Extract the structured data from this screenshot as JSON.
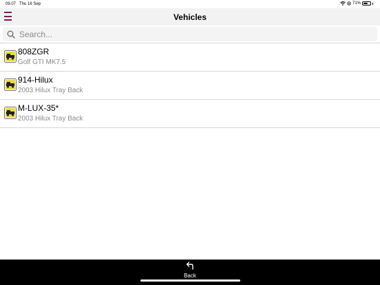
{
  "status_bar": {
    "time": "09.07",
    "date": "Thu 16 Sep",
    "battery_percent": "71%",
    "battery_level": 0.71
  },
  "nav": {
    "title": "Vehicles",
    "menu_icon": "hamburger-menu-icon",
    "menu_color": "#7a1f4a"
  },
  "search": {
    "placeholder": "Search...",
    "value": ""
  },
  "vehicles": [
    {
      "name": "808ZGR",
      "model": "Golf GTI MK7.5",
      "icon": "vehicle-icon"
    },
    {
      "name": "914-Hilux",
      "model": "2003 Hilux Tray Back",
      "icon": "vehicle-icon"
    },
    {
      "name": "M-LUX-35*",
      "model": "2003 Hilux Tray Back",
      "icon": "vehicle-icon"
    }
  ],
  "toolbar": {
    "back_label": "Back",
    "back_icon": "back-arrow-icon"
  },
  "colors": {
    "accent": "#7a1f4a",
    "vehicle_icon_fill": "#e8d84a",
    "toolbar_bg": "#000000"
  }
}
